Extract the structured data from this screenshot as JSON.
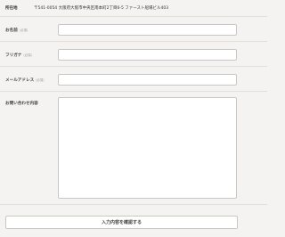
{
  "address": {
    "label": "所在地",
    "value": "〒541-0054 大阪府大阪市中央区南本町2丁目6-5 ファースト船場ビル403"
  },
  "form": {
    "name": {
      "label": "お名前",
      "required": "(必須)"
    },
    "furigana": {
      "label": "フリガナ",
      "required": "(必須)"
    },
    "email": {
      "label": "メールアドレス",
      "required": "(必須)"
    },
    "inquiry": {
      "label": "お問い合わせ内容",
      "required": ""
    }
  },
  "submit": {
    "label": "入力内容を確認する"
  }
}
